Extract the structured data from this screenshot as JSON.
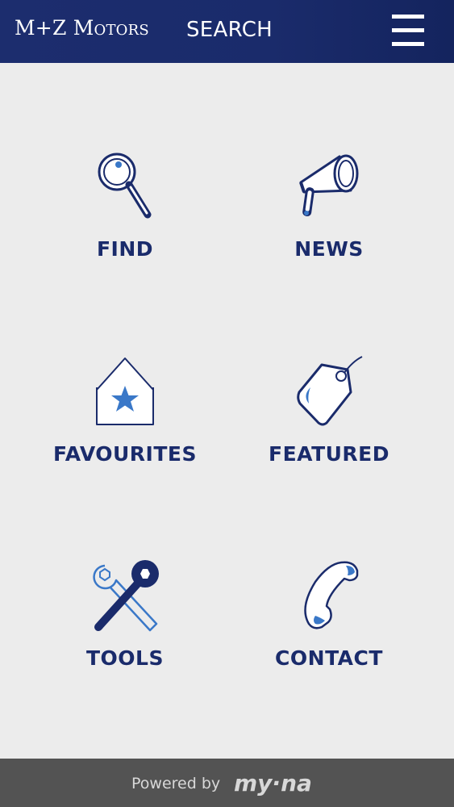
{
  "header": {
    "brand_initials": "M+Z",
    "brand_word": "Motors",
    "title": "SEARCH",
    "menu_icon": "hamburger-menu-icon"
  },
  "tiles": [
    {
      "label": "FIND",
      "icon": "magnifier-icon"
    },
    {
      "label": "NEWS",
      "icon": "megaphone-icon"
    },
    {
      "label": "FAVOURITES",
      "icon": "house-star-icon"
    },
    {
      "label": "FEATURED",
      "icon": "price-tag-icon"
    },
    {
      "label": "TOOLS",
      "icon": "wrench-tools-icon"
    },
    {
      "label": "CONTACT",
      "icon": "phone-handset-icon"
    }
  ],
  "footer": {
    "powered_by": "Powered by",
    "logo_text": "my·na"
  },
  "colors": {
    "header_bg": "#1a2b6b",
    "accent_blue": "#3a78c8",
    "navy": "#1a2b6b",
    "background": "#ececec",
    "footer_bg": "#535353"
  }
}
